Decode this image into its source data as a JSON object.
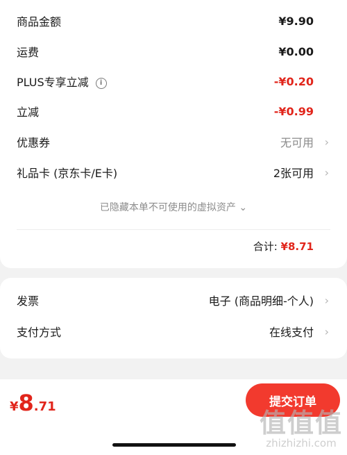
{
  "summary": {
    "items": [
      {
        "label": "商品金额",
        "value": "¥9.90"
      },
      {
        "label": "运费",
        "value": "¥0.00"
      },
      {
        "label": "PLUS专享立减",
        "value": "-¥0.20"
      },
      {
        "label": "立减",
        "value": "-¥0.99"
      },
      {
        "label": "优惠券",
        "value": "无可用"
      },
      {
        "label": "礼品卡 (京东卡/E卡)",
        "value": "2张可用"
      }
    ],
    "info_icon_text": "i",
    "chevron": "›",
    "hidden_assets": "已隐藏本单不可使用的虚拟资产",
    "hidden_assets_arrow": "⌄",
    "total_label": "合计:",
    "total_value": "¥8.71"
  },
  "invoice": {
    "items": [
      {
        "label": "发票",
        "value": "电子 (商品明细-个人)"
      },
      {
        "label": "支付方式",
        "value": "在线支付"
      }
    ]
  },
  "bottom": {
    "currency": "¥",
    "price_int": "8",
    "price_dec": ".71",
    "submit_label": "提交订单"
  },
  "watermark": {
    "line1": "值值值",
    "line2": "zhizhizhi.com"
  },
  "colors": {
    "accent_red": "#e1251b",
    "button_red": "#f23a2e"
  }
}
